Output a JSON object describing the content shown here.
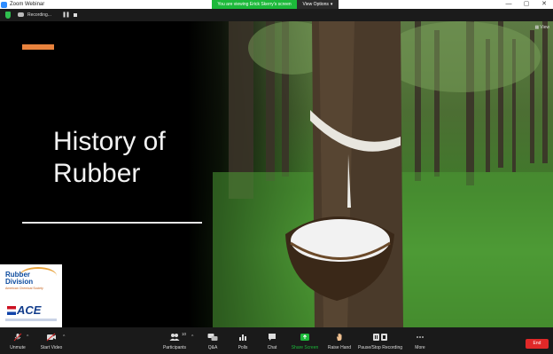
{
  "window": {
    "title": "Zoom Webinar",
    "viewing_banner": "You are viewing Erick Skerry's screen",
    "view_options": "View Options",
    "controls": {
      "minimize": "—",
      "restore": "▢",
      "close": "✕"
    }
  },
  "recording": {
    "status": "Recording..."
  },
  "slide": {
    "title": "History of Rubber",
    "view_label": "View",
    "accent_color": "#e8823d"
  },
  "logos": {
    "rubber_division_line1": "Rubber",
    "rubber_division_line2": "Division",
    "rubber_division_sub": "American Chemical Society",
    "ace": "ACE"
  },
  "toolbar": {
    "unmute": "Unmute",
    "start_video": "Start Video",
    "participants": "Participants",
    "participants_count": "10",
    "qa": "Q&A",
    "polls": "Polls",
    "chat": "Chat",
    "share_screen": "Share Screen",
    "raise_hand": "Raise Hand",
    "pause_stop_recording": "Pause/Stop Recording",
    "more": "More",
    "end": "End"
  },
  "colors": {
    "share_green": "#1cb93a",
    "end_red": "#e02828",
    "toolbar_bg": "#1a1a1a"
  }
}
